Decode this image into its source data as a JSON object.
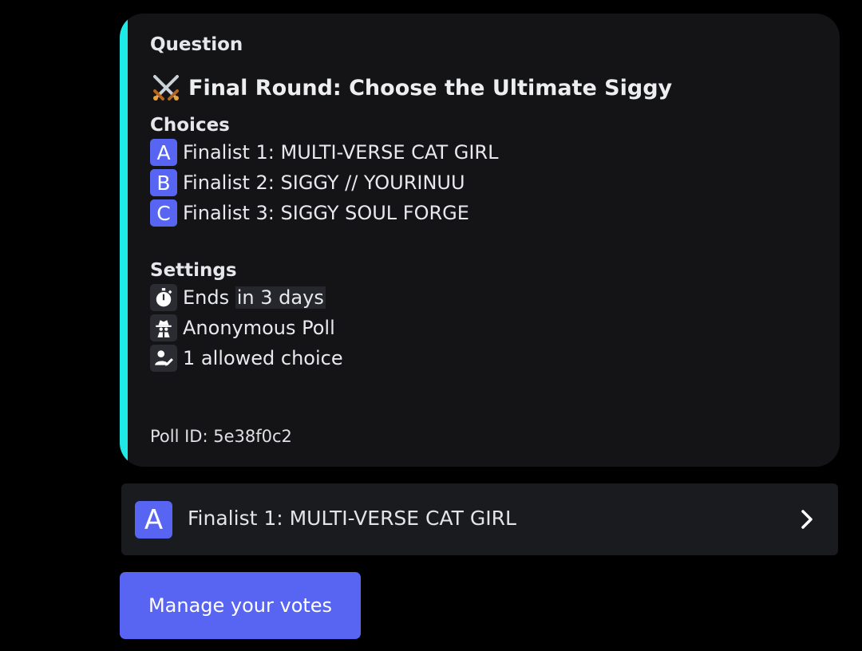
{
  "embed": {
    "accent_color": "#1de9e6",
    "question_heading": "Question",
    "question_icon": "crossed-swords-icon",
    "question_text": "Final Round: Choose the Ultimate Siggy",
    "choices_heading": "Choices",
    "choices": [
      {
        "letter": "A",
        "label": "Finalist 1: MULTI-VERSE CAT GIRL"
      },
      {
        "letter": "B",
        "label": "Finalist 2: SIGGY // YOURINUU"
      },
      {
        "letter": "C",
        "label": "Finalist 3: SIGGY SOUL FORGE"
      }
    ],
    "settings_heading": "Settings",
    "settings": {
      "ends_prefix": "Ends",
      "ends_highlight": "in 3 days",
      "anonymous": "Anonymous Poll",
      "allowed": "1 allowed choice"
    },
    "poll_id": "Poll ID: 5e38f0c2"
  },
  "select": {
    "letter": "A",
    "label": "Finalist 1: MULTI-VERSE CAT GIRL",
    "icon": "chevron-right-icon"
  },
  "manage_button": {
    "label": "Manage your votes",
    "color": "#5865f2"
  }
}
